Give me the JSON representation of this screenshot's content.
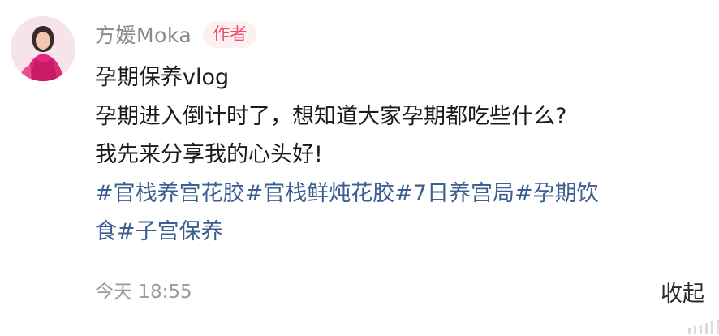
{
  "comment": {
    "author": {
      "name": "方媛Moka",
      "badge": "作者"
    },
    "content_lines": [
      "孕期保养vlog",
      "孕期进入倒计时了，想知道大家孕期都吃些什么?",
      "我先来分享我的心头好!"
    ],
    "hashtag_lines": [
      "#官栈养宫花胶#官栈鲜炖花胶#7日养宫局#孕期饮",
      "食#子宫保养"
    ],
    "timestamp": "今天 18:55",
    "collapse_label": "收起"
  },
  "colors": {
    "badge_text": "#ee4f67",
    "badge_bg": "#fdf0f2",
    "hashtag": "#3b5f90",
    "name": "#8a8a8a"
  }
}
